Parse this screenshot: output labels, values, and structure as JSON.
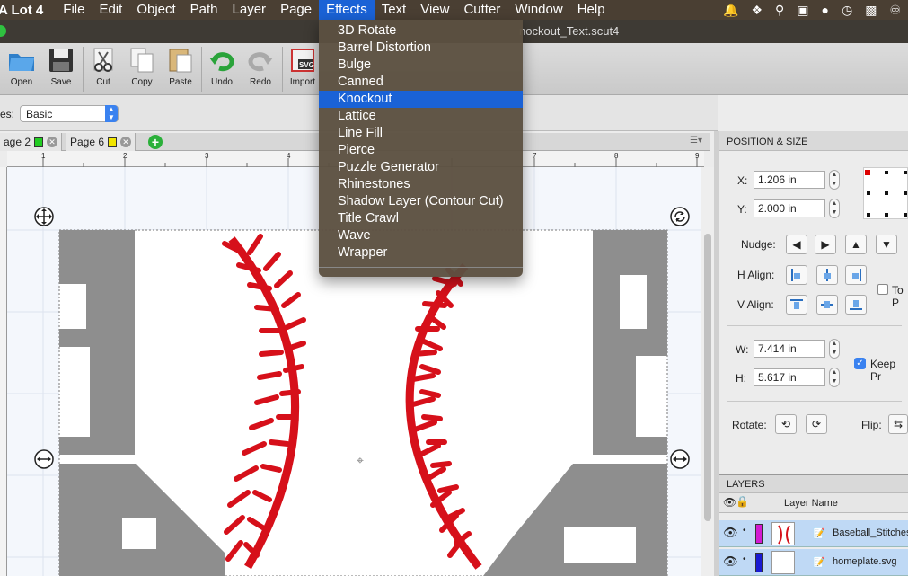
{
  "menubar": {
    "app_name": "A Lot 4",
    "items": [
      "File",
      "Edit",
      "Object",
      "Path",
      "Layer",
      "Page",
      "Effects",
      "Text",
      "View",
      "Cutter",
      "Window",
      "Help"
    ],
    "active": "Effects"
  },
  "window": {
    "title": "nockout_Text.scut4"
  },
  "toolbar": {
    "open": "Open",
    "save": "Save",
    "cut": "Cut",
    "copy": "Copy",
    "paste": "Paste",
    "undo": "Undo",
    "redo": "Redo",
    "import": "Import"
  },
  "optbar": {
    "label": "es:",
    "select_value": "Basic"
  },
  "pagetabs": [
    {
      "label": "age 2",
      "swatch": "#22cc22"
    },
    {
      "label": "Page 6",
      "swatch": "#f2e600"
    }
  ],
  "ruler": {
    "ticks": [
      "1",
      "2",
      "3",
      "4",
      "7",
      "8",
      "9"
    ]
  },
  "effects_menu": {
    "items": [
      "3D Rotate",
      "Barrel Distortion",
      "Bulge",
      "Canned",
      "Knockout",
      "Lattice",
      "Line Fill",
      "Pierce",
      "Puzzle Generator",
      "Rhinestones",
      "Shadow Layer (Contour Cut)",
      "Title Crawl",
      "Wave",
      "Wrapper"
    ],
    "highlighted": "Knockout"
  },
  "position_size": {
    "header": "POSITION & SIZE",
    "x_label": "X:",
    "x_value": "1.206 in",
    "y_label": "Y:",
    "y_value": "2.000 in",
    "nudge_label": "Nudge:",
    "halign_label": "H Align:",
    "valign_label": "V Align:",
    "to_label": "To P",
    "w_label": "W:",
    "w_value": "7.414 in",
    "h_label": "H:",
    "h_value": "5.617 in",
    "keep_label": "Keep Pr",
    "rotate_label": "Rotate:",
    "flip_label": "Flip:"
  },
  "layers": {
    "header": "LAYERS",
    "col_name": "Layer Name",
    "rows": [
      {
        "name": "Baseball_Stitches.",
        "color": "#d21ad2"
      },
      {
        "name": "homeplate.svg",
        "color": "#1a1ad2"
      }
    ]
  },
  "colors": {
    "accent": "#1a62d6",
    "stitch": "#d6101a",
    "letters": "#8e8e8e"
  }
}
